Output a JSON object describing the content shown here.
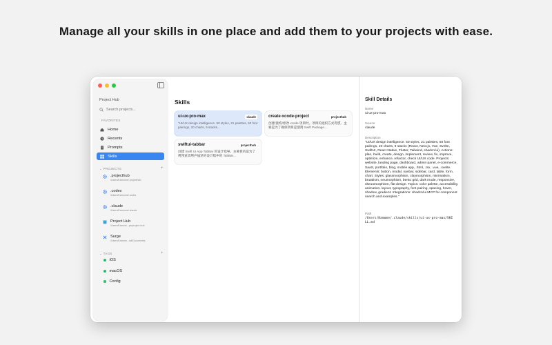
{
  "headline": "Manage all your skills in one place and add them to your projects with ease.",
  "sidebar": {
    "app_title": "Project Hub",
    "search_placeholder": "Search projects...",
    "favorites_label": "FAVORITES",
    "favorites": [
      {
        "label": "Home",
        "icon": "home-icon"
      },
      {
        "label": "Recents",
        "icon": "clock-icon"
      },
      {
        "label": "Prompts",
        "icon": "document-icon"
      },
      {
        "label": "Skills",
        "icon": "grid-icon"
      }
    ],
    "projects_label": "PROJECTS",
    "projects": [
      {
        "name": ".projecthub",
        "path": "/Users/Kamome/.projecthub",
        "icon": "gear-icon"
      },
      {
        "name": ".codex",
        "path": "/Users/Kamome/.codex",
        "icon": "gear-icon"
      },
      {
        "name": ".claude",
        "path": "/Users/Kamome/.claude",
        "icon": "gear-icon"
      },
      {
        "name": "Project Hub",
        "path": "/Users/Kamom...ps/project-hub",
        "icon": "box-icon"
      },
      {
        "name": "Surge",
        "path": "/Users/Kamom...ncl/Documents",
        "icon": "tools-icon"
      }
    ],
    "tags_label": "TAGS",
    "tags": [
      {
        "label": "iOS"
      },
      {
        "label": "macOS"
      },
      {
        "label": "Config"
      }
    ]
  },
  "main": {
    "title": "Skills",
    "cards": [
      {
        "name": "ui-ux-pro-max",
        "badge": "claude",
        "desc": "\"UI/UX design intelligence. 50 styles, 21 palettes, 50 font pairings, 20 charts, 9 stacks..."
      },
      {
        "name": "create-xcode-project",
        "badge": "projecthub",
        "desc": "创建/重构/修改 xcode 项目时，项目的组织方式有惯、主要是为了确保项目是使用 Swift Package..."
      },
      {
        "name": "swiftui-tabbar",
        "badge": "projecthub",
        "desc": "创建 Swift UI App TabBar 的设计指导，主要目的是为了用预览调用户描述的设计稿中的 TabBar..."
      }
    ]
  },
  "details": {
    "title": "Skill Details",
    "name_label": "Name",
    "name_value": "ui-ux-pro-max",
    "source_label": "Source",
    "source_value": "claude",
    "description_label": "Description",
    "description_value": "\"UI/UX design intelligence. 50 styles, 21 palettes, 50 font pairings, 20 charts, 9 stacks (React, Next.js, Vue, Svelte, SwiftUI, React Native, Flutter, Tailwind, shadcn/ui). Actions: plan, build, create, design, implement, review, fix, improve, optimize, enhance, refactor, check UI/UX code. Projects: website, landing page, dashboard, admin panel, e-commerce, SaaS, portfolio, blog, mobile app, .html, .tsx, .vue, .svelte. Elements: button, modal, navbar, sidebar, card, table, form, chart. Styles: glassmorphism, claymorphism, minimalism, brutalism, neumorphism, bento grid, dark mode, responsive, skeuomorphism, flat design. Topics: color palette, accessibility, animation, layout, typography, font pairing, spacing, hover, shadow, gradient. Integrations: shadcn/ui MCP for component search and examples.\"",
    "path_label": "Path",
    "path_value": "/Users/Kamome/.claude/skills/ui-ux-pro-max/SKILL.md"
  },
  "colors": {
    "accent": "#3a86f0",
    "selected_card": "#dde9fb",
    "tag_dot": "#2fbf71"
  }
}
